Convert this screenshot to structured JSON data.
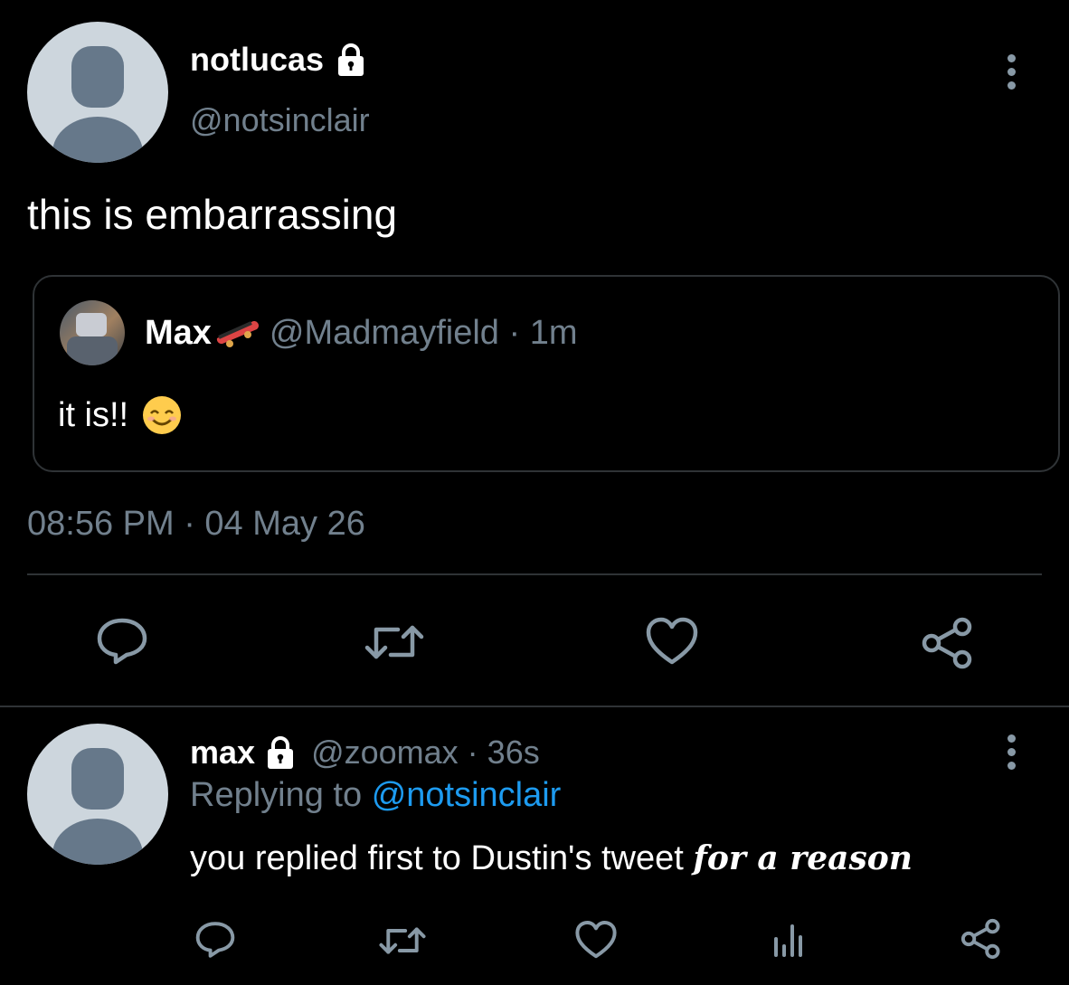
{
  "main_tweet": {
    "display_name": "notlucas",
    "handle": "@notsinclair",
    "text": "this is embarrassing",
    "timestamp": "08:56 PM · 04 May 26",
    "quoted": {
      "display_name": "Max",
      "handle": "@Madmayfield",
      "sep": " · ",
      "age": "1m",
      "text": "it is!!"
    }
  },
  "reply": {
    "display_name": "max",
    "handle": "@zoomax",
    "sep": " · ",
    "age": "36s",
    "replying_label": "Replying to",
    "replying_handle": "@notsinclair",
    "text": "you replied first to Dustin's tweet",
    "text_emphasis": "for a reason"
  },
  "icons": {
    "lock": "lock-icon",
    "more": "more-vertical-icon",
    "reply": "reply-icon",
    "retweet": "retweet-icon",
    "like": "heart-icon",
    "share": "share-icon",
    "analytics": "analytics-icon",
    "emoji": "smiling-face-emoji",
    "skateboard": "skateboard-emoji"
  },
  "colors": {
    "background": "#000000",
    "muted": "#71808d",
    "link": "#1d9bf0",
    "border": "#2f3336"
  }
}
